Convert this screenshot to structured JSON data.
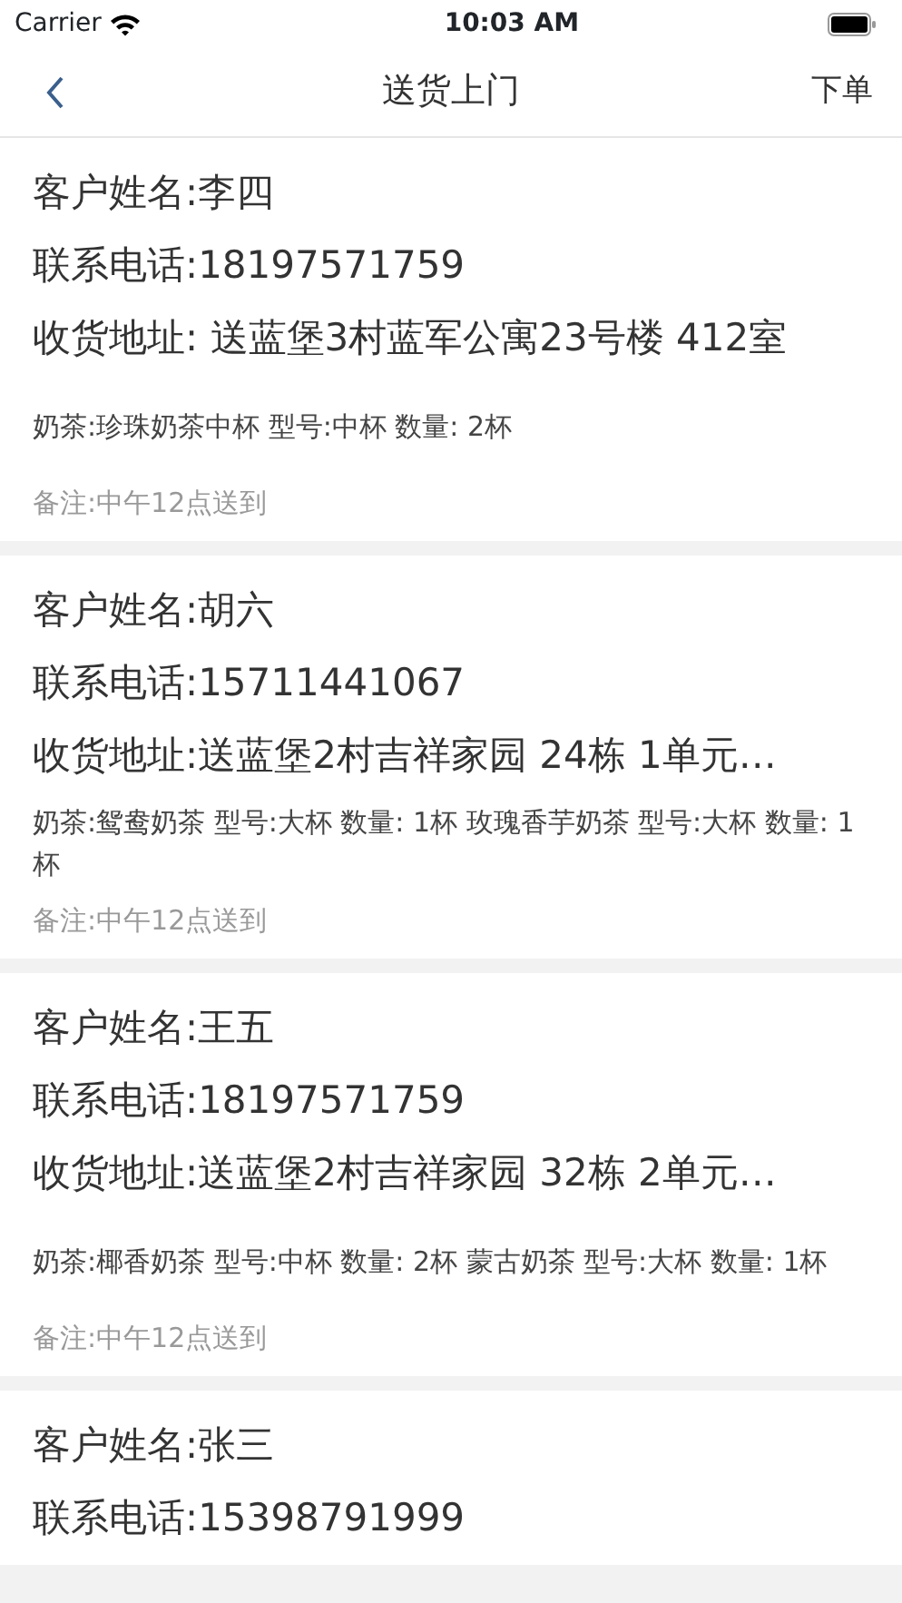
{
  "status_bar": {
    "carrier": "Carrier",
    "time": "10:03 AM"
  },
  "nav": {
    "title": "送货上门",
    "action": "下单"
  },
  "orders": [
    {
      "name": "客户姓名:李四",
      "phone": "联系电话:18197571759",
      "address": "收货地址: 送蓝堡3村蓝军公寓23号楼 412室",
      "items": "奶茶:珍珠奶茶中杯 型号:中杯 数量: 2杯",
      "note": "备注:中午12点送到"
    },
    {
      "name": "客户姓名:胡六",
      "phone": "联系电话:15711441067",
      "address": "收货地址:送蓝堡2村吉祥家园 24栋 1单元…",
      "items": "奶茶:鸳鸯奶茶 型号:大杯 数量: 1杯   玫瑰香芋奶茶 型号:大杯 数量: 1杯",
      "note": "备注:中午12点送到"
    },
    {
      "name": "客户姓名:王五",
      "phone": "联系电话:18197571759",
      "address": "收货地址:送蓝堡2村吉祥家园 32栋 2单元…",
      "items": "奶茶:椰香奶茶 型号:中杯 数量: 2杯   蒙古奶茶 型号:大杯 数量: 1杯",
      "note": "备注:中午12点送到"
    },
    {
      "name": "客户姓名:张三",
      "phone": "联系电话:15398791999"
    }
  ]
}
